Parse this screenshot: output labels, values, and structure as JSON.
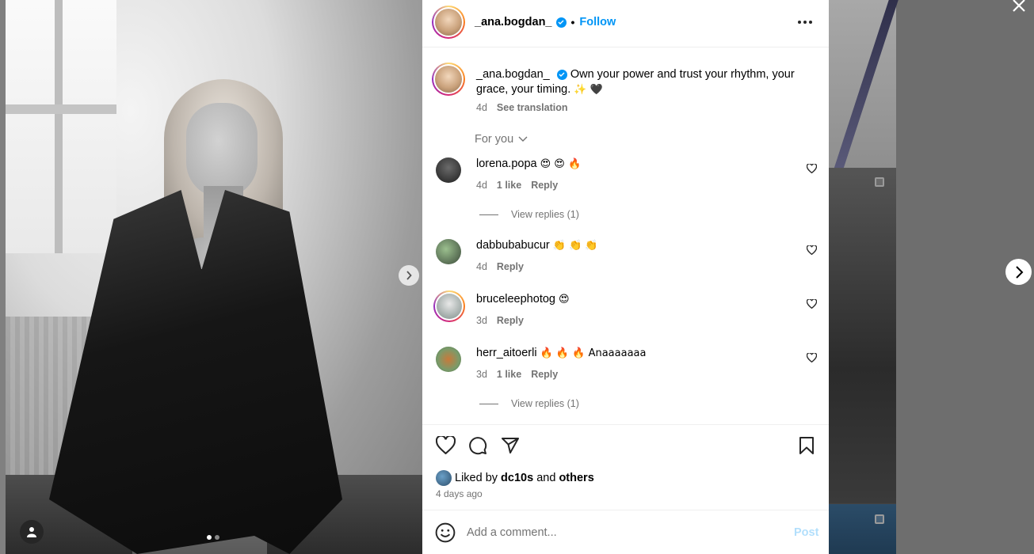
{
  "post": {
    "username": "_ana.bogdan_",
    "separator": "•",
    "follow_label": "Follow",
    "caption_text": "Own your power and trust your rhythm, your grace, your timing.",
    "caption_emojis": "✨ 🖤",
    "caption_time": "4d",
    "see_translation": "See translation",
    "sort_label": "For you"
  },
  "comments": [
    {
      "user": "lorena.popa",
      "text": "😍 😍 🔥",
      "time": "4d",
      "likes": "1 like",
      "reply": "Reply",
      "replies": "View replies (1)"
    },
    {
      "user": "dabbubabucur",
      "text": "👏 👏 👏",
      "time": "4d",
      "likes": "",
      "reply": "Reply",
      "replies": ""
    },
    {
      "user": "bruceleephotog",
      "text": "😍",
      "time": "3d",
      "likes": "",
      "reply": "Reply",
      "replies": ""
    },
    {
      "user": "herr_aitoerli",
      "text": "🔥 🔥 🔥 Anaaaaaaa",
      "time": "3d",
      "likes": "1 like",
      "reply": "Reply",
      "replies": "View replies (1)"
    }
  ],
  "likes": {
    "prefix": "Liked by",
    "user": "dc10s",
    "connector": "and",
    "others": "others",
    "posted": "4 days ago"
  },
  "composer": {
    "placeholder": "Add a comment...",
    "post_label": "Post"
  },
  "icons": {
    "close": "close-icon",
    "next": "chevron-right-icon",
    "like": "heart-icon",
    "comment": "comment-icon",
    "share": "share-icon",
    "save": "bookmark-icon",
    "emoji": "emoji-icon",
    "more": "more-icon",
    "tag": "user-tag-icon"
  },
  "colors": {
    "accent": "#0095f6",
    "muted": "#737373",
    "post_disabled": "#b2dffc"
  }
}
